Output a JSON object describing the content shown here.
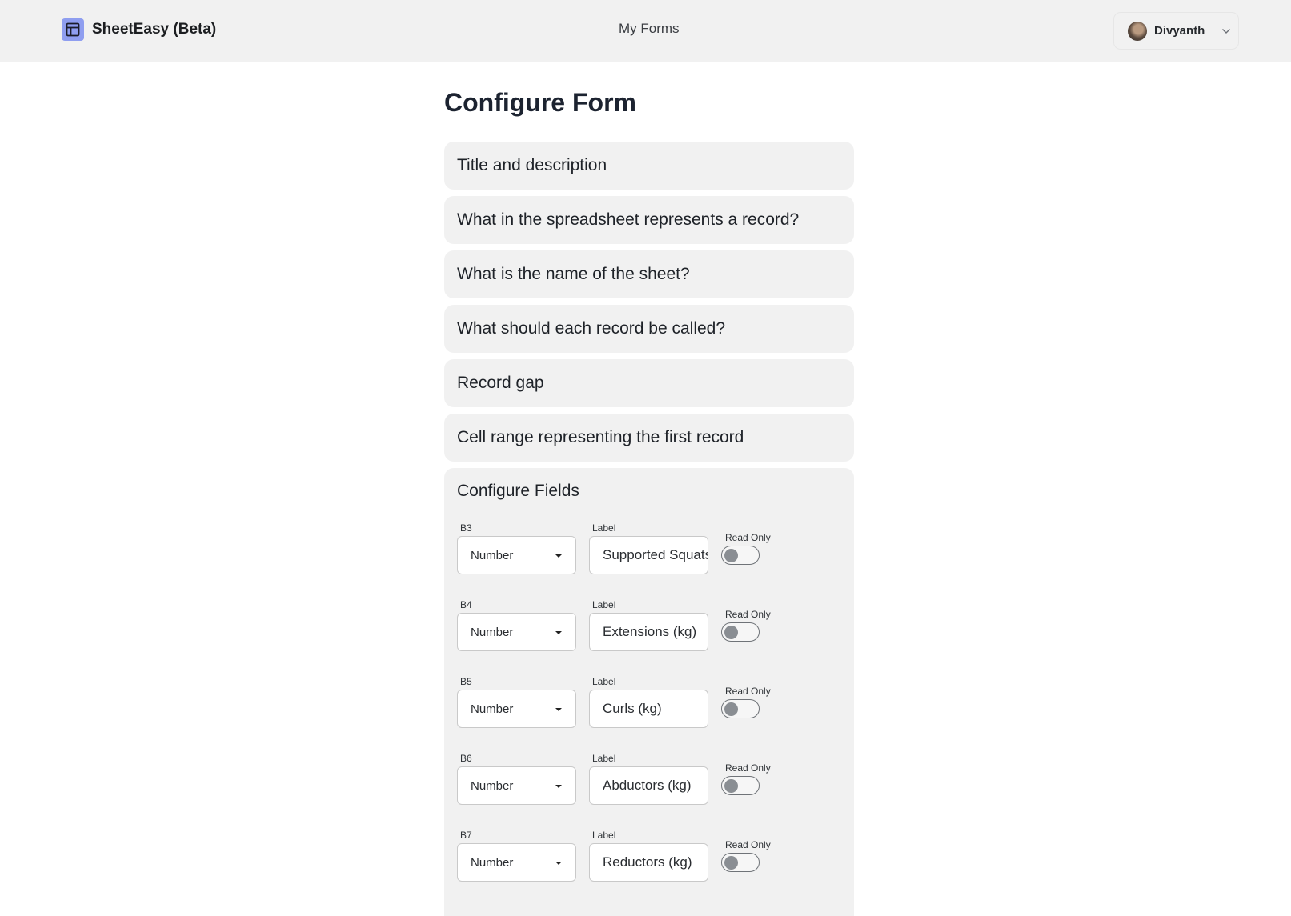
{
  "header": {
    "app_name": "SheetEasy (Beta)",
    "nav_link": "My Forms",
    "user_name": "Divyanth"
  },
  "page_title": "Configure Form",
  "sections": [
    "Title and description",
    "What in the spreadsheet represents a record?",
    "What is the name of the sheet?",
    "What should each record be called?",
    "Record gap",
    "Cell range representing the first record"
  ],
  "fields_panel": {
    "title": "Configure Fields",
    "label_caption": "Label",
    "read_only_caption": "Read Only",
    "rows": [
      {
        "cell": "B3",
        "type": "Number",
        "label": "Supported Squats (kg)",
        "read_only": false
      },
      {
        "cell": "B4",
        "type": "Number",
        "label": "Extensions (kg)",
        "read_only": false
      },
      {
        "cell": "B5",
        "type": "Number",
        "label": "Curls (kg)",
        "read_only": false
      },
      {
        "cell": "B6",
        "type": "Number",
        "label": "Abductors (kg)",
        "read_only": false
      },
      {
        "cell": "B7",
        "type": "Number",
        "label": "Reductors (kg)",
        "read_only": false
      }
    ]
  },
  "colors": {
    "header_bg": "#f1f1f1",
    "brand_icon": "#8f9ef0",
    "panel_bg": "#f1f1f1"
  }
}
